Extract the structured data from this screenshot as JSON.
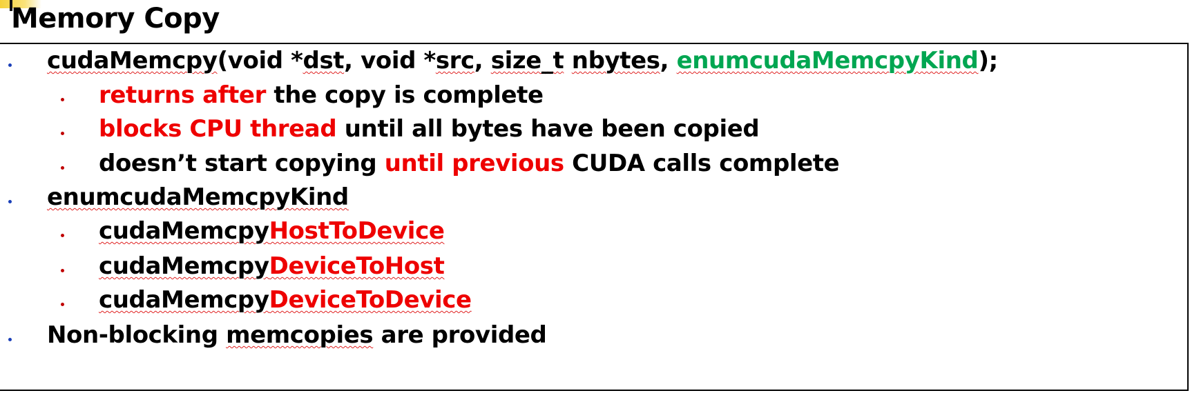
{
  "slide": {
    "title": "Memory Copy",
    "items": [
      {
        "parts": [
          {
            "text": "cudaMemcpy",
            "style": "black",
            "squiggle": true
          },
          {
            "text": "(void *",
            "style": "black",
            "squiggle": false
          },
          {
            "text": "dst",
            "style": "black",
            "squiggle": true
          },
          {
            "text": ", void *",
            "style": "black",
            "squiggle": false
          },
          {
            "text": "src",
            "style": "black",
            "squiggle": true
          },
          {
            "text": ", ",
            "style": "black",
            "squiggle": false
          },
          {
            "text": "size_t",
            "style": "black",
            "squiggle": true
          },
          {
            "text": " ",
            "style": "black",
            "squiggle": false
          },
          {
            "text": "nbytes",
            "style": "black",
            "squiggle": true
          },
          {
            "text": ", ",
            "style": "black",
            "squiggle": false
          },
          {
            "text": "enumcudaMemcpyKind",
            "style": "green",
            "squiggle": true
          },
          {
            "text": ");",
            "style": "black",
            "squiggle": false
          }
        ]
      },
      {
        "parts": [
          {
            "text": "returns after",
            "style": "red",
            "squiggle": false
          },
          {
            "text": " the copy is complete",
            "style": "black",
            "squiggle": false
          }
        ]
      },
      {
        "parts": [
          {
            "text": "blocks CPU thread",
            "style": "red",
            "squiggle": false
          },
          {
            "text": " until all bytes have been copied",
            "style": "black",
            "squiggle": false
          }
        ]
      },
      {
        "parts": [
          {
            "text": "doesn’t start copying ",
            "style": "black",
            "squiggle": false
          },
          {
            "text": "until previous",
            "style": "red",
            "squiggle": false
          },
          {
            "text": " CUDA calls complete",
            "style": "black",
            "squiggle": false
          }
        ]
      },
      {
        "parts": [
          {
            "text": "enumcudaMemcpyKind",
            "style": "black",
            "squiggle": true
          }
        ]
      },
      {
        "parts": [
          {
            "text": "cudaMemcpy",
            "style": "black",
            "squiggle": true
          },
          {
            "text": "HostToDevice",
            "style": "red",
            "squiggle": true
          }
        ]
      },
      {
        "parts": [
          {
            "text": "cudaMemcpy",
            "style": "black",
            "squiggle": true
          },
          {
            "text": "DeviceToHost",
            "style": "red",
            "squiggle": true
          }
        ]
      },
      {
        "parts": [
          {
            "text": "cudaMemcpy",
            "style": "black",
            "squiggle": true
          },
          {
            "text": "DeviceToDevice",
            "style": "red",
            "squiggle": true
          }
        ]
      },
      {
        "parts": [
          {
            "text": "Non-blocking ",
            "style": "black",
            "squiggle": false
          },
          {
            "text": "memcopies",
            "style": "black",
            "squiggle": true
          },
          {
            "text": " are provided",
            "style": "black",
            "squiggle": false
          }
        ]
      }
    ]
  },
  "colors": {
    "highlight_red": "#ee0000",
    "highlight_green": "#00a651",
    "bullet_level1": "#1a3fb8",
    "bullet_level2": "#c00000",
    "text": "#000000"
  }
}
